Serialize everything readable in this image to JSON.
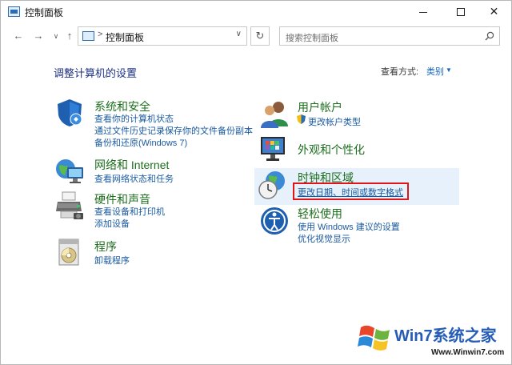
{
  "window": {
    "title": "控制面板"
  },
  "nav": {
    "back": "←",
    "forward": "→",
    "recent": "∨",
    "up": "↑",
    "address_separator": ">",
    "address_text": "控制面板",
    "address_dropdown": "∨",
    "refresh": "↻"
  },
  "search": {
    "placeholder": "搜索控制面板"
  },
  "content": {
    "heading": "调整计算机的设置",
    "view_by_label": "查看方式:",
    "view_by_value": "类别",
    "view_by_caret": "▼"
  },
  "categories": {
    "system": {
      "title": "系统和安全",
      "links": [
        "查看你的计算机状态",
        "通过文件历史记录保存你的文件备份副本",
        "备份和还原(Windows 7)"
      ]
    },
    "network": {
      "title": "网络和 Internet",
      "links": [
        "查看网络状态和任务"
      ]
    },
    "hardware": {
      "title": "硬件和声音",
      "links": [
        "查看设备和打印机",
        "添加设备"
      ]
    },
    "programs": {
      "title": "程序",
      "links": [
        "卸载程序"
      ]
    },
    "users": {
      "title": "用户帐户",
      "links": [
        "更改帐户类型"
      ]
    },
    "appearance": {
      "title": "外观和个性化",
      "links": []
    },
    "clock": {
      "title": "时钟和区域",
      "links": [
        "更改日期、时间或数字格式"
      ]
    },
    "ease": {
      "title": "轻松使用",
      "links": [
        "使用 Windows 建议的设置",
        "优化视觉显示"
      ]
    }
  },
  "watermark": {
    "brand": "Win7系统之家",
    "url": "Www.Winwin7.com"
  },
  "colors": {
    "category_title": "#1d6e1d",
    "link": "#1a5aa0",
    "heading": "#1e3287",
    "highlight": "#e6f1fb",
    "annotation_box": "#e0151a"
  }
}
